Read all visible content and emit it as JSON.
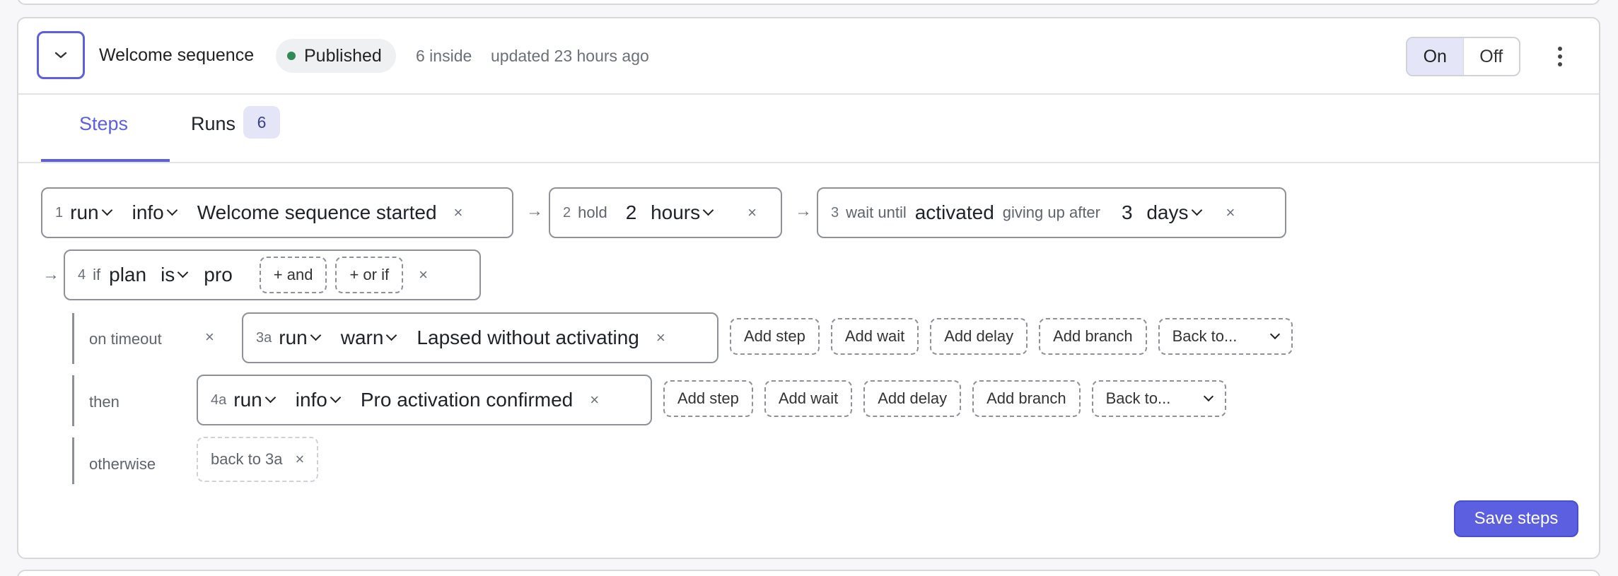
{
  "sequence": {
    "title": "Welcome sequence",
    "status": "Published",
    "inside_count": "6 inside",
    "updated": "updated 23 hours ago",
    "toggle": {
      "on": "On",
      "off": "Off",
      "active": "On"
    }
  },
  "tabs": [
    {
      "label": "Steps",
      "active": true
    },
    {
      "label": "Runs",
      "count": "6"
    }
  ],
  "steps": [
    {
      "num": "1",
      "action": "run",
      "level": "info",
      "message": "Welcome sequence started",
      "remove": "×"
    },
    {
      "num": "2",
      "label": "hold",
      "amount": "2",
      "unit": "hours",
      "remove": "×"
    },
    {
      "num": "3",
      "label": "wait until",
      "event": "activated",
      "giveup_label": "giving up after",
      "amount": "3",
      "unit": "days",
      "remove": "×"
    },
    {
      "num": "4",
      "label": "if",
      "field": "plan",
      "op": "is",
      "value": "pro",
      "and_label": "+ and",
      "or_label": "+ or if",
      "remove": "×"
    }
  ],
  "arrow": "→",
  "branches": {
    "timeout": {
      "label": "on timeout",
      "remove": "×",
      "step": {
        "num": "3a",
        "action": "run",
        "level": "warn",
        "message": "Lapsed without activating",
        "remove": "×"
      }
    },
    "then": {
      "label": "then",
      "step": {
        "num": "4a",
        "action": "run",
        "level": "info",
        "message": "Pro activation confirmed",
        "remove": "×"
      }
    },
    "otherwise": {
      "label": "otherwise",
      "ghost": "back to 3a",
      "remove": "×"
    }
  },
  "row_actions": {
    "add_step": "Add step",
    "add_wait": "Add wait",
    "add_delay": "Add delay",
    "add_branch": "Add branch",
    "back_to": "Back to..."
  },
  "save_label": "Save steps",
  "colors": {
    "accent": "#5b5fe0",
    "status_dot": "#2f8a55"
  },
  "icons": {
    "expand": "chevron-down-icon",
    "menu": "more-vertical-icon"
  }
}
